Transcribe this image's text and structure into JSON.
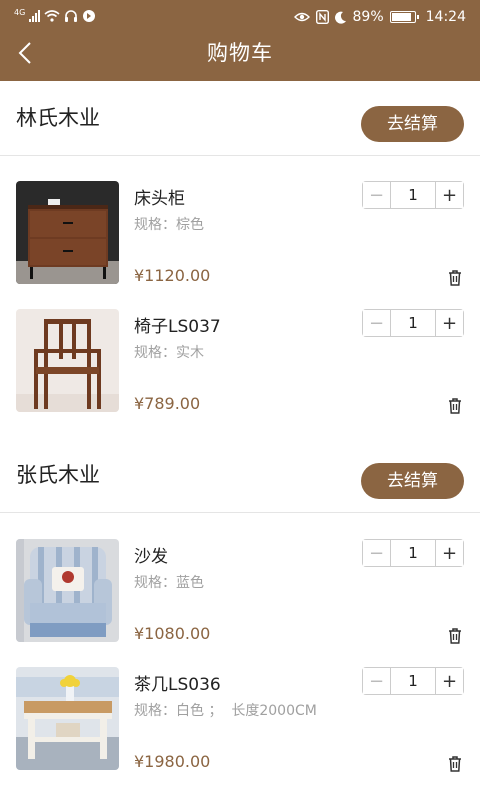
{
  "status_bar": {
    "network": "4G",
    "battery": "89%",
    "battery_level": 0.89,
    "time": "14:24",
    "left_icons": [
      "signal-icon",
      "wifi-icon",
      "headset-icon",
      "vpn-icon"
    ],
    "right_icons": [
      "eye-icon",
      "nfc-icon",
      "moon-icon",
      "battery-icon"
    ]
  },
  "nav": {
    "title": "购物车",
    "back_icon": "chevron-left-icon"
  },
  "colors": {
    "brand": "#8b6542",
    "price": "#8b6542",
    "spec": "#a0a0a0",
    "divider": "#e5e5e5"
  },
  "shops": [
    {
      "name": "林氏木业",
      "checkout_label": "去结算",
      "items": [
        {
          "name": "床头柜",
          "spec": "规格：棕色",
          "price": "¥1120.00",
          "qty": "1",
          "image": "nightstand-image"
        },
        {
          "name": "椅子LS037",
          "spec": "规格：实木",
          "price": "¥789.00",
          "qty": "1",
          "image": "chair-image"
        }
      ]
    },
    {
      "name": "张氏木业",
      "checkout_label": "去结算",
      "items": [
        {
          "name": "沙发",
          "spec": "规格：蓝色",
          "price": "¥1080.00",
          "qty": "1",
          "image": "sofa-image"
        },
        {
          "name": "茶几LS036",
          "spec": "规格：白色 ；  长度2000CM",
          "price": "¥1980.00",
          "qty": "1",
          "image": "coffee-table-image"
        }
      ]
    }
  ]
}
